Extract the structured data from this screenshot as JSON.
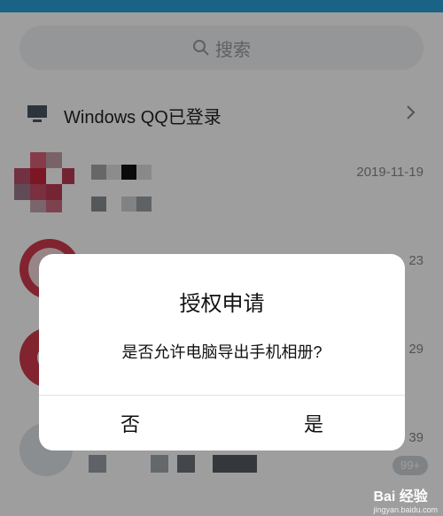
{
  "search": {
    "placeholder": "搜索",
    "icon": "search-icon"
  },
  "pc_login": {
    "label": "Windows QQ已登录",
    "icon": "computer-icon"
  },
  "conversations": [
    {
      "date": "2019-11-19"
    },
    {
      "date": "23"
    },
    {
      "date": "29"
    },
    {
      "date": "39"
    }
  ],
  "unread_badge": "99+",
  "dialog": {
    "title": "授权申请",
    "message": "是否允许电脑导出手机相册?",
    "deny_label": "否",
    "allow_label": "是"
  },
  "watermark": {
    "brand": "Bai 经验",
    "url": "jingyan.baidu.com"
  },
  "colors": {
    "accent": "#2b9fd8",
    "avatar_red": "#d03a4c"
  }
}
